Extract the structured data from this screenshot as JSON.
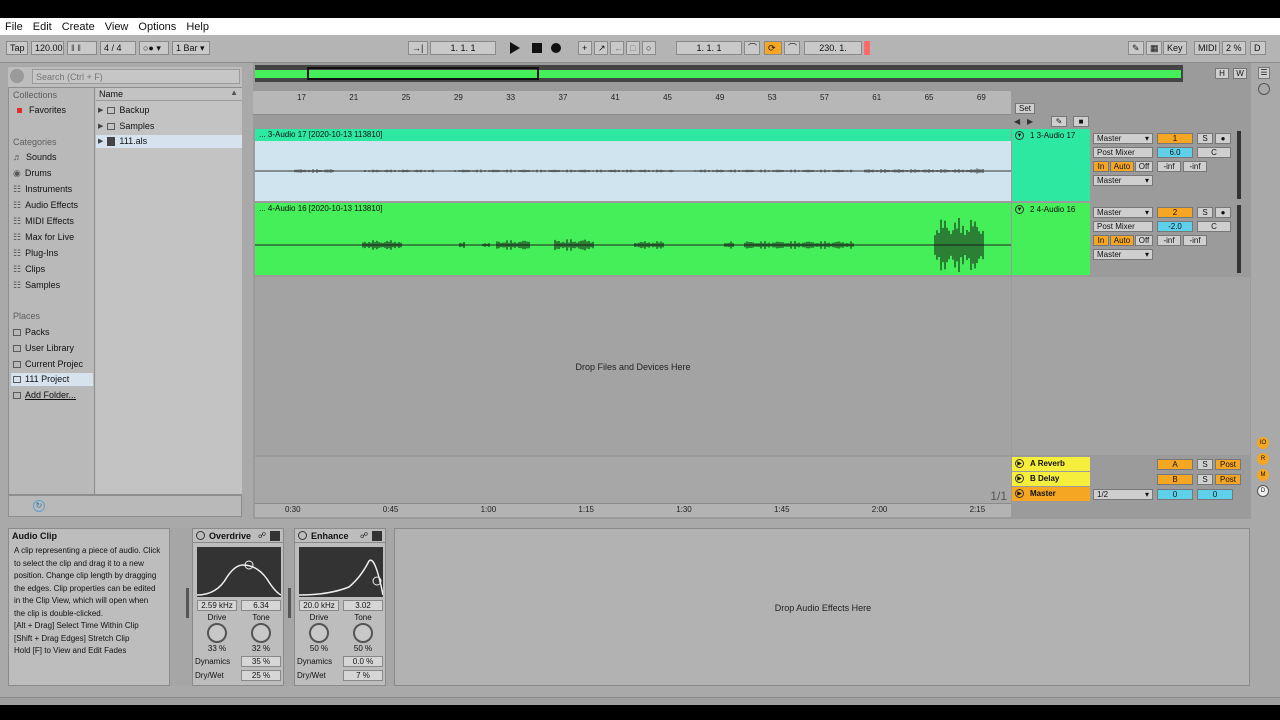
{
  "menu": [
    "File",
    "Edit",
    "Create",
    "View",
    "Options",
    "Help"
  ],
  "control_bar": {
    "tap": "Tap",
    "tempo": "120.00",
    "meter_num": "4",
    "meter_den": "4",
    "quantize": "1 Bar",
    "arrangement_pos": "1.   1.   1",
    "punch_in": "1.   1.   1",
    "loop_length": "230.   1.",
    "key": "Key",
    "midi": "MIDI",
    "cpu": "2 %",
    "d": "D"
  },
  "colors": {
    "green": "#45ef5a",
    "teal": "#2de8a0",
    "clip_blue": "#cfe4ef",
    "orange": "#f5a623",
    "blue_box": "#5fd0ea",
    "yellow": "#f6ee3c"
  },
  "browser": {
    "search_placeholder": "Search (Ctrl + F)",
    "collections_header": "Collections",
    "favorites": "Favorites",
    "categories_header": "Categories",
    "categories": [
      "Sounds",
      "Drums",
      "Instruments",
      "Audio Effects",
      "MIDI Effects",
      "Max for Live",
      "Plug-Ins",
      "Clips",
      "Samples"
    ],
    "places_header": "Places",
    "places": [
      "Packs",
      "User Library",
      "Current Projec",
      "111 Project",
      "Add Folder..."
    ],
    "name_header": "Name",
    "files": [
      "Backup",
      "Samples",
      "111.als"
    ]
  },
  "arrangement": {
    "ruler_bars": [
      "17",
      "21",
      "25",
      "29",
      "33",
      "37",
      "41",
      "45",
      "49",
      "53",
      "57",
      "61",
      "65",
      "69"
    ],
    "time_ticks": [
      "0:30",
      "0:45",
      "1:00",
      "1:15",
      "1:30",
      "1:45",
      "2:00",
      "2:15"
    ],
    "set_label": "Set",
    "drop_files_text": "Drop Files and Devices Here",
    "page_indicator": "1/1",
    "overview_h": "H",
    "overview_w": "W"
  },
  "tracks": [
    {
      "clip_title": "... 3-Audio 17 [2020-10-13 113810]",
      "name": "1 3-Audio 17",
      "output": "Master",
      "monitor": "Post Mixer",
      "input": "Master",
      "number": "1",
      "volume": "6.0",
      "pan": "C",
      "in_label": "In",
      "auto_label": "Auto",
      "off_label": "Off",
      "meter_l": "-inf",
      "meter_r": "-inf",
      "solo": "S"
    },
    {
      "clip_title": "... 4-Audio 16 [2020-10-13 113810]",
      "name": "2 4-Audio 16",
      "output": "Master",
      "monitor": "Post Mixer",
      "input": "Master",
      "number": "2",
      "volume": "-2.0",
      "pan": "C",
      "in_label": "In",
      "auto_label": "Auto",
      "off_label": "Off",
      "meter_l": "-inf",
      "meter_r": "-inf",
      "solo": "S"
    }
  ],
  "returns": [
    {
      "name": "A Reverb",
      "letter": "A",
      "solo": "S",
      "post": "Post"
    },
    {
      "name": "B Delay",
      "letter": "B",
      "solo": "S",
      "post": "Post"
    }
  ],
  "master": {
    "name": "Master",
    "cue": "1/2",
    "vol_a": "0",
    "vol_b": "0"
  },
  "info_view": {
    "title": "Audio Clip",
    "lines": [
      "A clip representing a piece of audio. Click",
      "to select the clip and drag it to a new",
      "position. Change clip length by dragging",
      "the edges. Clip properties can be edited",
      "in the Clip View, which will open when",
      "the clip is double-clicked.",
      "[Alt + Drag] Select Time Within Clip",
      "[Shift + Drag Edges] Stretch Clip",
      "Hold [F] to View and Edit Fades"
    ]
  },
  "devices": [
    {
      "title": "Overdrive",
      "freq": "2.59 kHz",
      "width": "6.34",
      "knob1_label": "Drive",
      "knob2_label": "Tone",
      "knob1_value": "33 %",
      "knob2_value": "32 %",
      "row1_label": "Dynamics",
      "row1_value": "35 %",
      "row2_label": "Dry/Wet",
      "row2_value": "25 %"
    },
    {
      "title": "Enhance",
      "freq": "20.0 kHz",
      "width": "3.02",
      "knob1_label": "Drive",
      "knob2_label": "Tone",
      "knob1_value": "50 %",
      "knob2_value": "50 %",
      "row1_label": "Dynamics",
      "row1_value": "0.0 %",
      "row2_label": "Dry/Wet",
      "row2_value": "7 %"
    }
  ],
  "drop_effects_text": "Drop Audio Effects Here"
}
